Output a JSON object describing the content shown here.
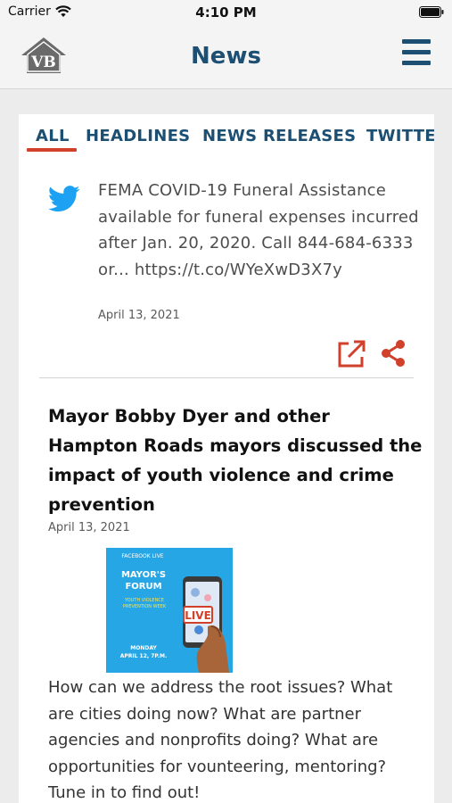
{
  "status_bar": {
    "carrier": "Carrier",
    "time": "4:10 PM"
  },
  "header": {
    "logo_text": "VB",
    "title": "News"
  },
  "tabs": [
    {
      "label": "ALL"
    },
    {
      "label": "HEADLINES"
    },
    {
      "label": "NEWS RELEASES"
    },
    {
      "label": "TWITTE"
    }
  ],
  "feed": {
    "tweet": {
      "text": "FEMA COVID-19 Funeral Assistance available for funeral expenses incurred after Jan. 20, 2020. Call 844-684-6333 or... https://t.co/WYeXwD3X7y",
      "date": "April 13, 2021"
    },
    "article": {
      "title": "Mayor Bobby Dyer and other Hampton Roads mayors discussed the impact of youth violence and crime prevention",
      "date": "April 13, 2021",
      "image": {
        "kicker": "FACEBOOK LIVE",
        "heading": "MAYOR'S\nFORUM",
        "subheading": "YOUTH VIOLENCE PREVENTION WEEK",
        "footer": "MONDAY\nAPRIL 12, 7P.M.",
        "badge": "LIVE"
      },
      "body": "How can we address the root issues? What are cities doing now? What are partner agencies and nonprofits doing? What are opportunities for vounteering, mentoring? Tune in to find out!"
    }
  },
  "colors": {
    "brand_navy": "#1d4f73",
    "accent_red": "#d0402b",
    "twitter_blue": "#1da1f2",
    "promo_blue": "#27a6e6"
  },
  "icons": {
    "wifi": "wifi-icon",
    "battery": "battery-icon",
    "menu": "hamburger-menu-icon",
    "twitter": "twitter-bird-icon",
    "open_link": "external-link-icon",
    "share": "share-icon"
  }
}
